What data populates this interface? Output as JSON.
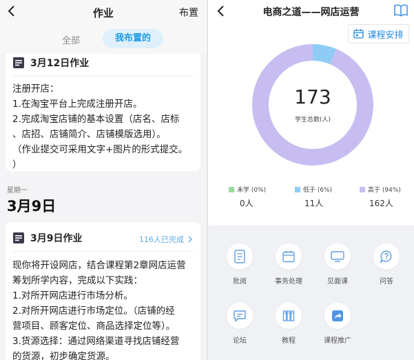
{
  "left": {
    "header": {
      "title": "作业",
      "action": "布置"
    },
    "tabs": [
      {
        "label": "全部",
        "active": false
      },
      {
        "label": "我布置的",
        "active": true
      }
    ],
    "assignments": [
      {
        "title": "3月12日作业",
        "lines": [
          "注册开店：",
          "1.在淘宝平台上完成注册开店。",
          "2.完成淘宝店铺的基本设置（店名、店标",
          "、店招、店铺简介、店铺模版选用）。",
          "（作业提交可采用文字+图片的形式提交。",
          "）"
        ]
      },
      {
        "title": "3月9日作业",
        "completed": "116人已完成",
        "lines": [
          "现你将开设网店，结合课程第2章网店运营",
          "筹划所学内容，完成以下实践：",
          "1.对所开网店进行市场分析。",
          "2.对所开网店进行市场定位。（店铺的经",
          "营项目、顾客定位、商品选择定位等）。",
          "3.货源选择：通过网络渠道寻找店铺经营",
          "的货源，初步确定货源。"
        ]
      }
    ],
    "date_group": {
      "weekday": "星期一",
      "date": "3月9日"
    }
  },
  "right": {
    "header": {
      "title": "电商之道——网店运营"
    },
    "schedule_button": "课程安排",
    "summary": {
      "total": "173",
      "label": "学生总数(人)"
    },
    "legend": [
      {
        "label": "未学 (0%)",
        "value": "0人",
        "color": "#9ad89e"
      },
      {
        "label": "低于 (6%)",
        "value": "11人",
        "color": "#8ecbf5"
      },
      {
        "label": "高于 (94%)",
        "value": "162人",
        "color": "#c7bdf1"
      }
    ],
    "tools": [
      {
        "label": "批阅",
        "icon": "document-icon"
      },
      {
        "label": "事务处理",
        "icon": "calendar-icon"
      },
      {
        "label": "见面课",
        "icon": "monitor-icon"
      },
      {
        "label": "问答",
        "icon": "question-bubble-icon"
      },
      {
        "label": "论坛",
        "icon": "chat-bubble-icon"
      },
      {
        "label": "教程",
        "icon": "books-icon"
      },
      {
        "label": "课程推广",
        "icon": "share-icon"
      }
    ]
  },
  "chart_data": {
    "type": "pie",
    "categories": [
      "未学",
      "低于",
      "高于"
    ],
    "values": [
      0,
      11,
      162
    ],
    "percentages": [
      0,
      6,
      94
    ],
    "colors": [
      "#9ad89e",
      "#8ecbf5",
      "#c7bdf1"
    ],
    "donut": true,
    "center_value": 173,
    "center_label": "学生总数(人)"
  }
}
